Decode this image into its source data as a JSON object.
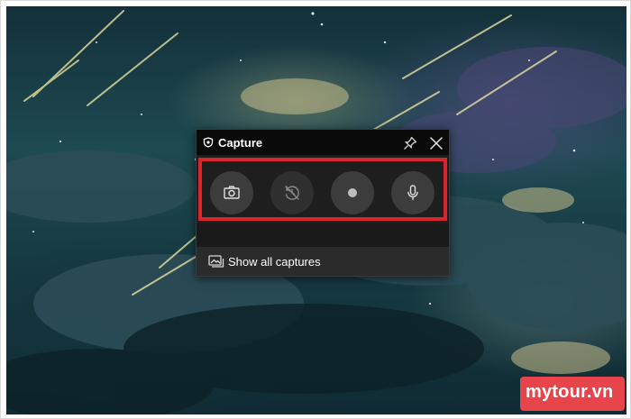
{
  "capture_widget": {
    "title": "Capture",
    "title_icon": "capture-widget-icon",
    "pin_icon": "pin-icon",
    "close_icon": "close-icon",
    "tools": [
      {
        "name": "screenshot-button",
        "icon": "camera-icon",
        "enabled": true
      },
      {
        "name": "record-last-30s-button",
        "icon": "history-disabled-icon",
        "enabled": false
      },
      {
        "name": "start-recording-button",
        "icon": "record-dot-icon",
        "enabled": true
      },
      {
        "name": "microphone-button",
        "icon": "microphone-icon",
        "enabled": true
      }
    ],
    "highlight_color": "#d7262e",
    "show_all_captures_label": "Show all captures",
    "gallery_icon": "gallery-icon"
  },
  "watermark": {
    "text": "mytour.vn",
    "color": "#e8444b"
  }
}
